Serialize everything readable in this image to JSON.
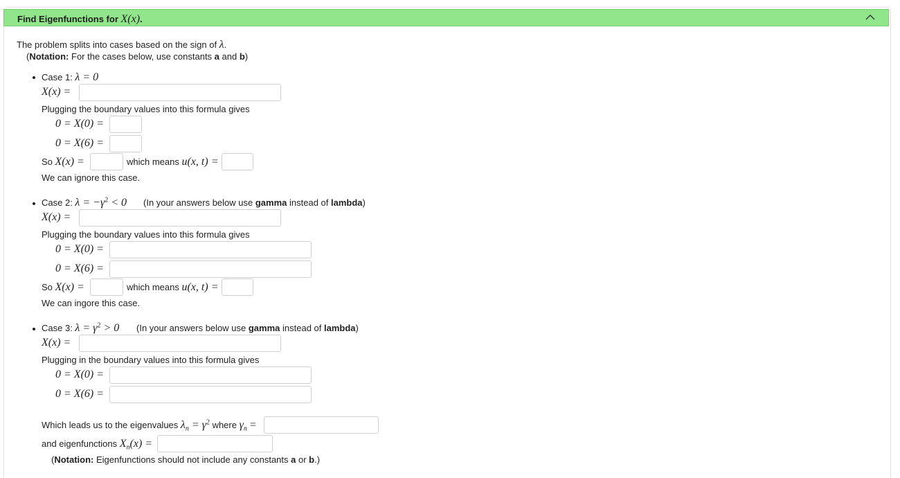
{
  "header": {
    "title_prefix": "Find Eigenfunctions for ",
    "title_math": "X(x)",
    "title_suffix": "."
  },
  "intro": {
    "line1_text": "The problem splits into cases based on the sign of ",
    "line1_math": "λ",
    "line1_end": ".",
    "notation_open": "(",
    "notation_bold": "Notation:",
    "notation_text": " For the cases below, use constants ",
    "notation_a": "a",
    "notation_and": " and ",
    "notation_b": "b",
    "notation_close": ")"
  },
  "case1": {
    "label": "Case 1: ",
    "cond": "λ = 0",
    "x_lhs": "X(x) =",
    "plug_text": "Plugging the boundary values into this formula gives",
    "eq1": "0 = X(0) =",
    "eq2": "0 = X(6) =",
    "so": "So ",
    "so_math": "X(x) =",
    "means": "which means ",
    "means_math": "u(x, t) =",
    "ignore": "We can ignore this case."
  },
  "case2": {
    "label": "Case 2: ",
    "cond_a": "λ = −γ",
    "cond_sup": "2",
    "cond_b": " < 0",
    "note_open": "(In your answers below use ",
    "note_bold1": "gamma",
    "note_mid": " instead of ",
    "note_bold2": "lambda",
    "note_close": ")",
    "x_lhs": "X(x) =",
    "plug_text": "Plugging the boundary values into this formula gives",
    "eq1": "0 = X(0) =",
    "eq2": "0 = X(6) =",
    "so": "So ",
    "so_math": "X(x) =",
    "means": "which means ",
    "means_math": "u(x, t) =",
    "ignore": "We can ingore this case."
  },
  "case3": {
    "label": "Case 3: ",
    "cond_a": "λ = γ",
    "cond_sup": "2",
    "cond_b": " > 0",
    "note_open": "(In your answers below use ",
    "note_bold1": "gamma",
    "note_mid": " instead of ",
    "note_bold2": "lambda",
    "note_close": ")",
    "x_lhs": "X(x) =",
    "plug_text": "Plugging in the boundary values into this formula gives",
    "eq1": "0 = X(0) =",
    "eq2": "0 = X(6) =",
    "eig_text": "Which leads us to the eigenvalues ",
    "eig_math_a": "λ",
    "eig_sub_n": "n",
    "eig_math_b": " = γ",
    "eig_sup": "2",
    "eig_where": " where ",
    "eig_gamma": "γ",
    "eig_eq": " =",
    "ef_text": "and eigenfunctions ",
    "ef_math_a": "X",
    "ef_math_b": "(x) =",
    "final_open": "(",
    "final_bold": "Notation:",
    "final_text": " Eigenfunctions should not include any constants ",
    "final_a": "a",
    "final_or": " or ",
    "final_b": "b",
    "final_close": ".)"
  },
  "inputs": {
    "c1_x": "",
    "c1_x0": "",
    "c1_x6": "",
    "c1_so": "",
    "c1_u": "",
    "c2_x": "",
    "c2_x0": "",
    "c2_x6": "",
    "c2_so": "",
    "c2_u": "",
    "c3_x": "",
    "c3_x0": "",
    "c3_x6": "",
    "c3_gamma": "",
    "c3_xn": ""
  },
  "colors": {
    "header_bg": "#91e58a",
    "header_border": "#7acc73"
  },
  "icons": {
    "collapse": "chevron-up-icon"
  }
}
